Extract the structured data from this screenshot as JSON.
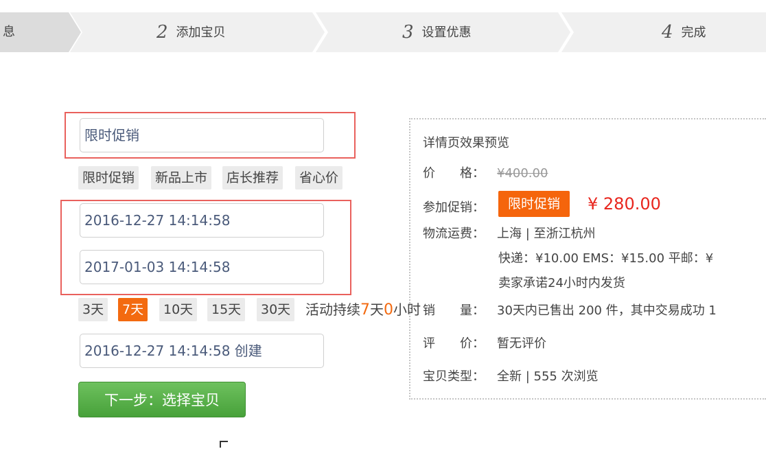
{
  "steps": [
    {
      "num": "",
      "label": "息"
    },
    {
      "num": "2",
      "label": "添加宝贝"
    },
    {
      "num": "3",
      "label": "设置优惠"
    },
    {
      "num": "4",
      "label": "完成"
    }
  ],
  "form": {
    "promo_name": "限时促销",
    "tags": [
      "限时促销",
      "新品上市",
      "店长推荐",
      "省心价"
    ],
    "start_time": "2016-12-27 14:14:58",
    "end_time": "2017-01-03 14:14:58",
    "durations": [
      {
        "label": "3天",
        "active": false
      },
      {
        "label": "7天",
        "active": true
      },
      {
        "label": "10天",
        "active": false
      },
      {
        "label": "15天",
        "active": false
      },
      {
        "label": "30天",
        "active": false
      }
    ],
    "duration_prefix": "活动持续",
    "duration_days": "7",
    "duration_day_unit": "天",
    "duration_hours": "0",
    "duration_hour_unit": "小时",
    "created": "2016-12-27 14:14:58 创建",
    "next_button": "下一步：选择宝贝"
  },
  "preview": {
    "title": "详情页效果预览",
    "price_label": "价　　格：",
    "original_price": "¥400.00",
    "promo_label": "参加促销：",
    "promo_badge": "限时促销",
    "promo_price": "¥ 280.00",
    "shipping_label": "物流运费：",
    "shipping_route": "上海 | 至浙江杭州",
    "shipping_fees": "快递：¥10.00 EMS：¥15.00 平邮：¥",
    "shipping_promise": "卖家承诺24小时内发货",
    "sales_label": "销　　量：",
    "sales_value": "30天内已售出 200 件，其中交易成功 1",
    "review_label": "评　　价：",
    "review_value": "暂无评价",
    "type_label": "宝贝类型：",
    "type_value": "全新 | 555 次浏览"
  },
  "colors": {
    "accent_orange": "#f36a10",
    "price_red": "#e8261e",
    "highlight_border": "#e9605c",
    "button_green": "#52ab44"
  }
}
